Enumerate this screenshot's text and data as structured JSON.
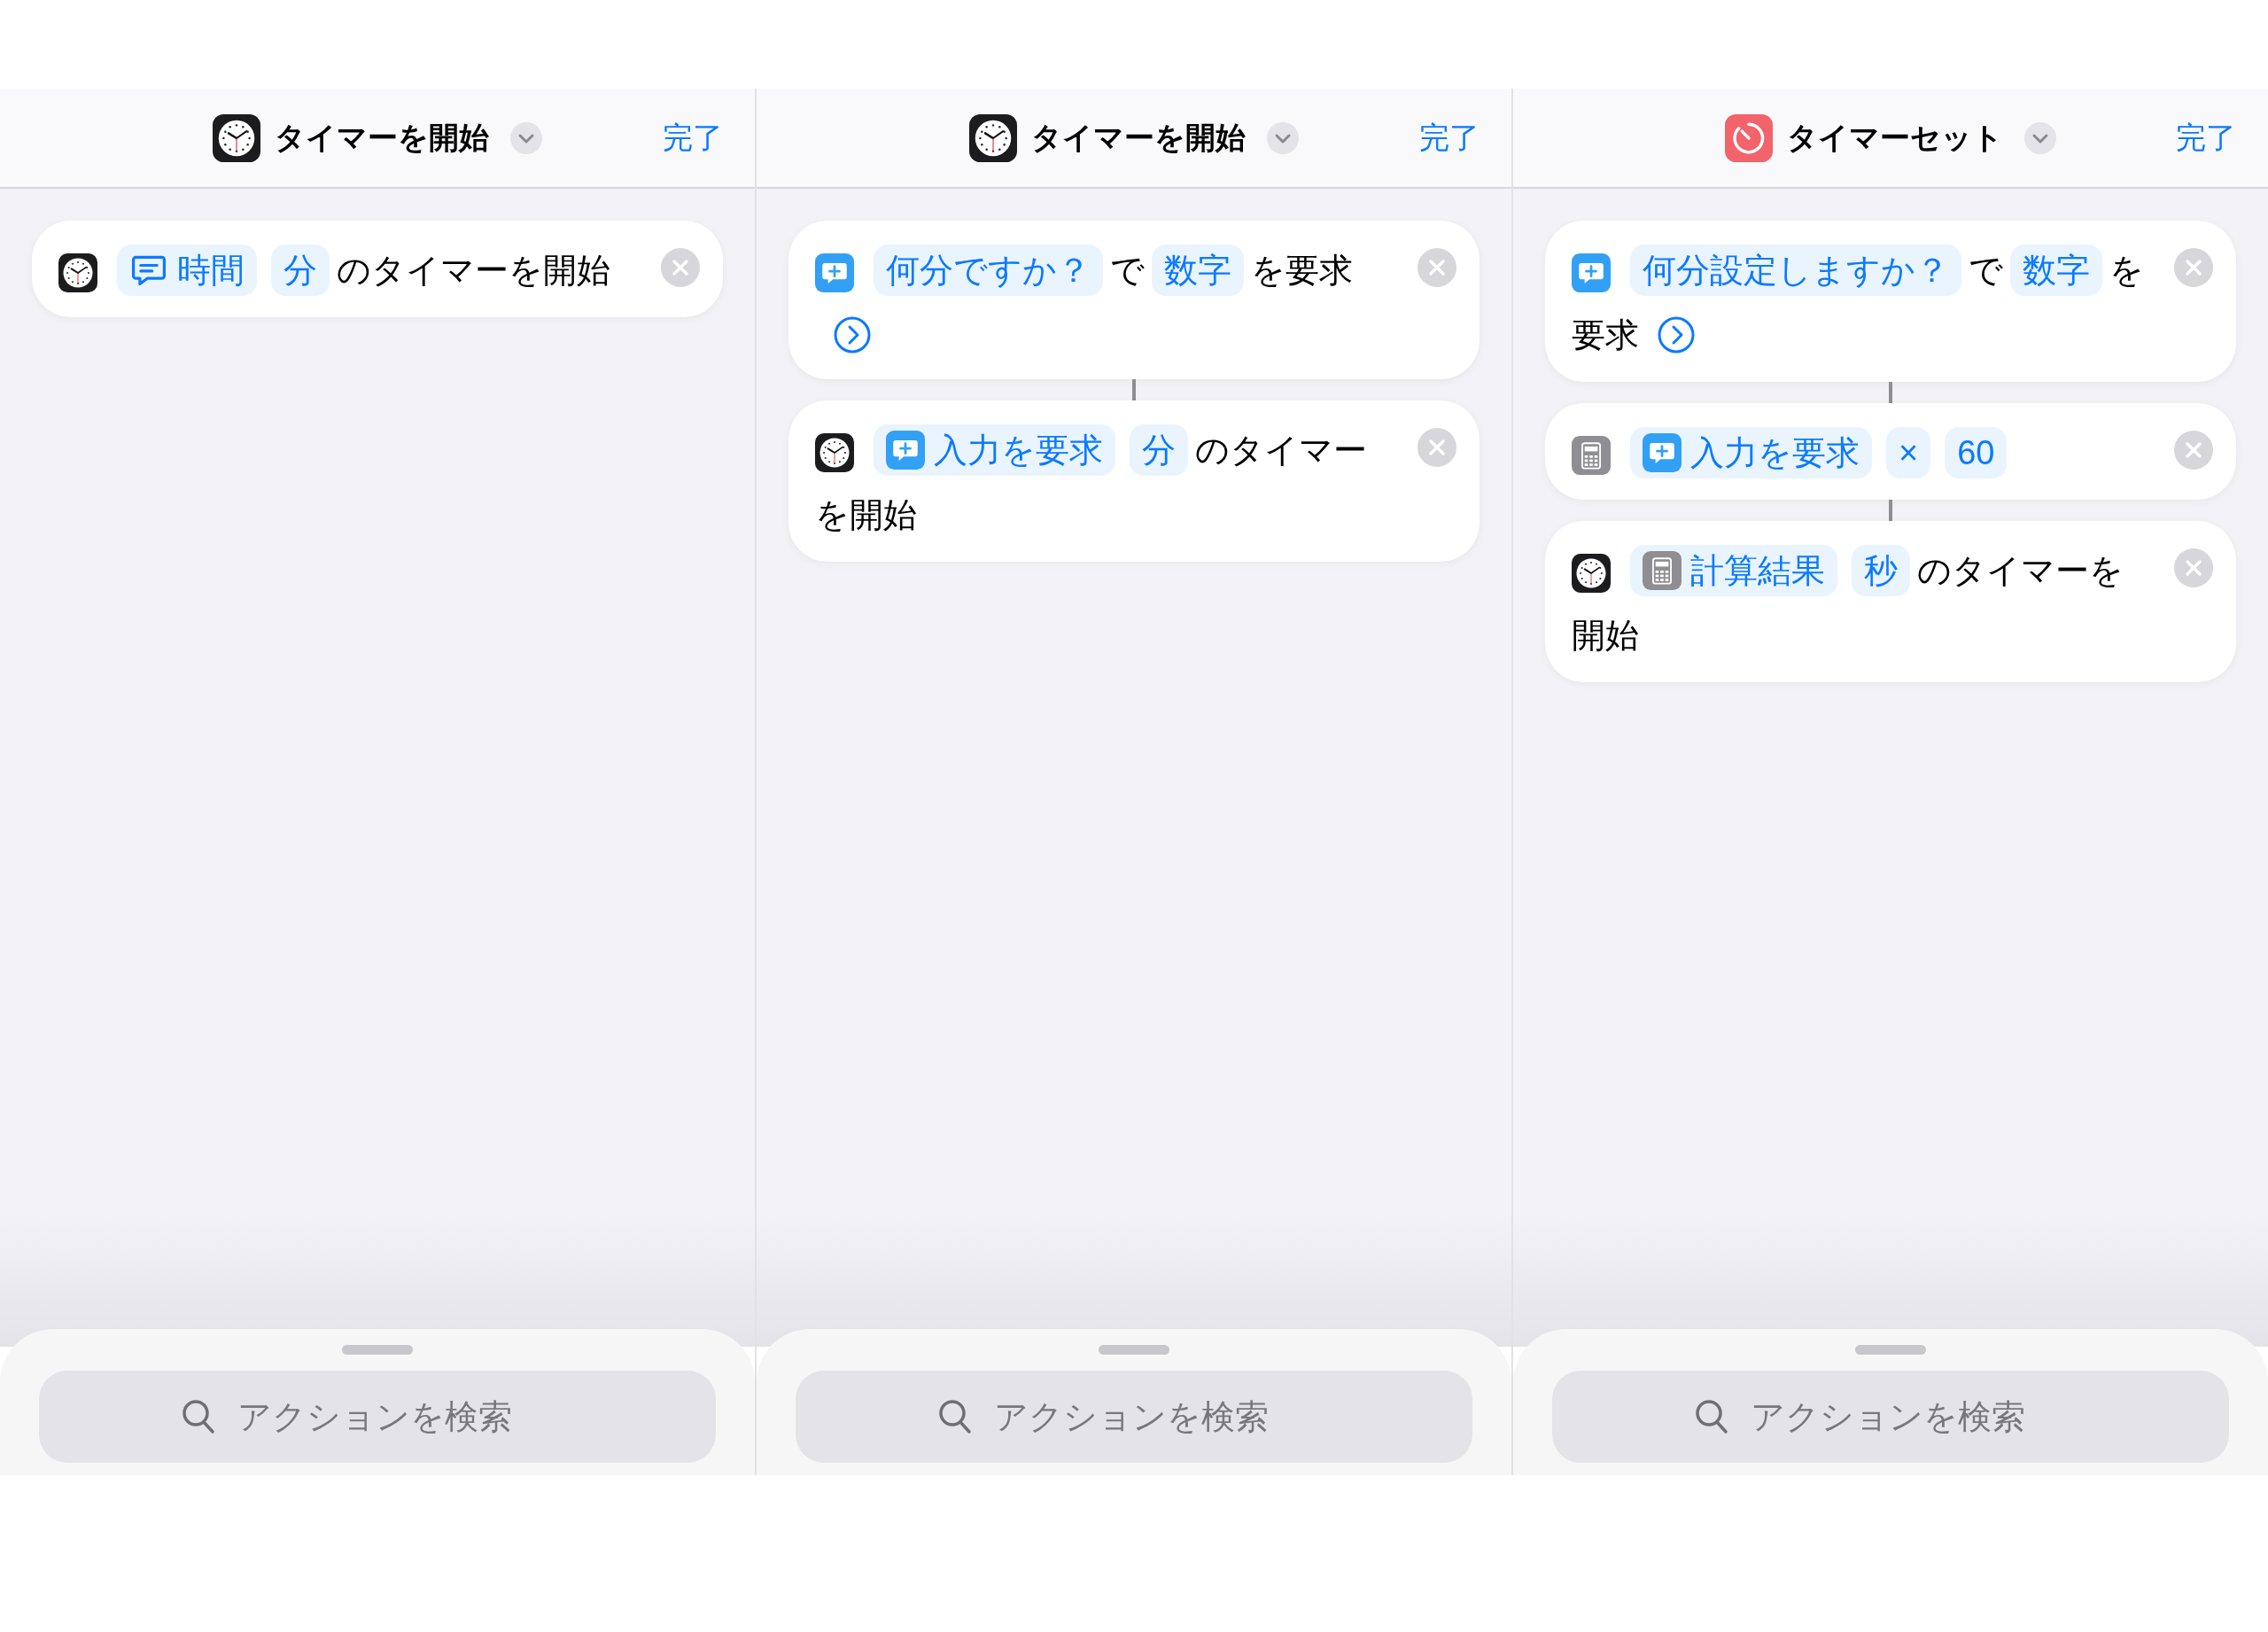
{
  "panels": [
    {
      "header": {
        "app_icon": {
          "kind": "clock"
        },
        "title": "タイマーを開始",
        "done": "完了"
      },
      "actions": [
        {
          "app_icon": {
            "kind": "clock"
          },
          "parts": [
            {
              "kind": "variable",
              "icon": {
                "kind": "message"
              },
              "text": "時間"
            },
            {
              "kind": "variable",
              "text": "分"
            },
            {
              "kind": "text",
              "text": "のタイマーを開始"
            }
          ]
        }
      ],
      "search": {
        "placeholder": "アクションを検索"
      }
    },
    {
      "header": {
        "app_icon": {
          "kind": "clock"
        },
        "title": "タイマーを開始",
        "done": "完了"
      },
      "actions": [
        {
          "app_icon": {
            "kind": "ask"
          },
          "parts": [
            {
              "kind": "variable",
              "text": "何分ですか？"
            },
            {
              "kind": "text",
              "text": "で"
            },
            {
              "kind": "variable",
              "text": "数字"
            },
            {
              "kind": "text",
              "text": "を要求"
            },
            {
              "kind": "more"
            }
          ]
        },
        {
          "app_icon": {
            "kind": "clock"
          },
          "parts": [
            {
              "kind": "variable",
              "icon": {
                "kind": "ask"
              },
              "text": "入力を要求"
            },
            {
              "kind": "variable",
              "text": "分"
            },
            {
              "kind": "text",
              "text": "のタイマーを開始"
            }
          ]
        }
      ],
      "search": {
        "placeholder": "アクションを検索"
      }
    },
    {
      "header": {
        "app_icon": {
          "kind": "timer"
        },
        "title": "タイマーセット",
        "done": "完了"
      },
      "actions": [
        {
          "app_icon": {
            "kind": "ask"
          },
          "parts": [
            {
              "kind": "variable",
              "text": "何分設定しますか？"
            },
            {
              "kind": "text",
              "text": "で"
            },
            {
              "kind": "variable",
              "text": "数字"
            },
            {
              "kind": "text",
              "text": "を要求"
            },
            {
              "kind": "more"
            }
          ]
        },
        {
          "app_icon": {
            "kind": "calculator"
          },
          "parts": [
            {
              "kind": "variable",
              "icon": {
                "kind": "ask"
              },
              "text": "入力を要求"
            },
            {
              "kind": "variable",
              "text": "×"
            },
            {
              "kind": "variable",
              "text": "60"
            }
          ]
        },
        {
          "app_icon": {
            "kind": "clock"
          },
          "parts": [
            {
              "kind": "variable",
              "icon": {
                "kind": "calculator"
              },
              "text": "計算結果"
            },
            {
              "kind": "variable",
              "text": "秒"
            },
            {
              "kind": "text",
              "text": "のタイマーを開始"
            }
          ]
        }
      ],
      "search": {
        "placeholder": "アクションを検索"
      }
    }
  ]
}
